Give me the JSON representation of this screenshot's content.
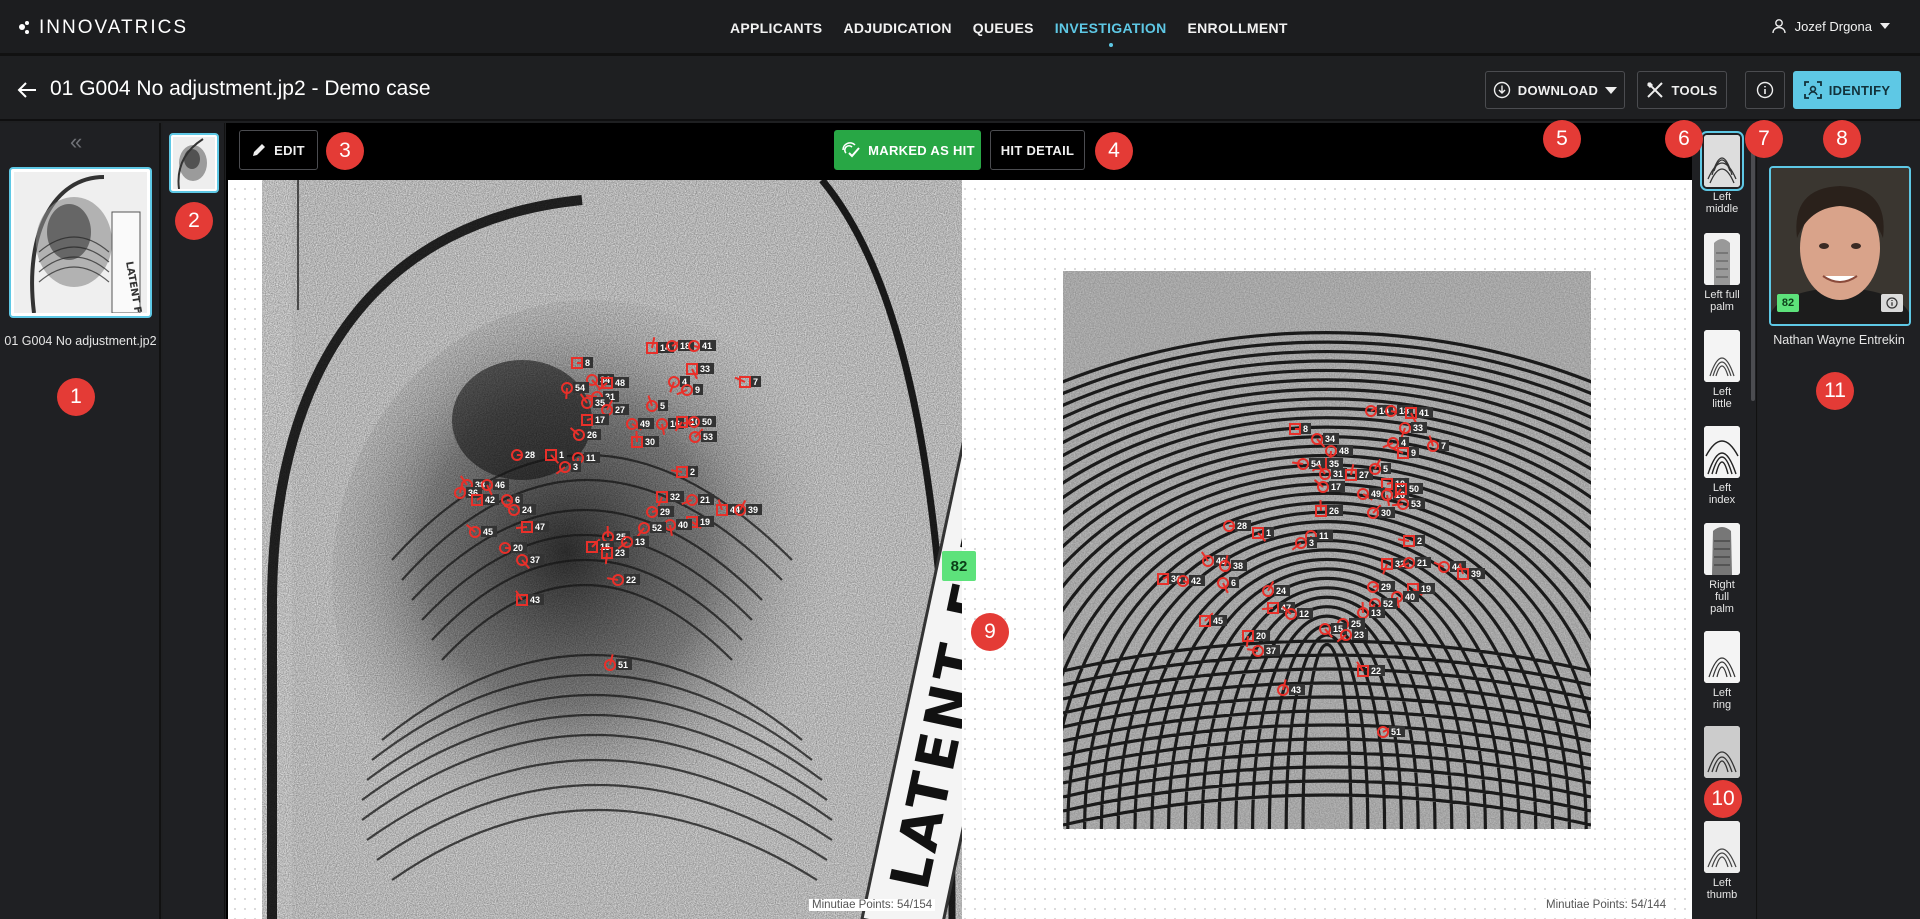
{
  "brand": {
    "name": "INNOVATRICS"
  },
  "nav": {
    "items": [
      {
        "label": "APPLICANTS"
      },
      {
        "label": "ADJUDICATION"
      },
      {
        "label": "QUEUES"
      },
      {
        "label": "INVESTIGATION",
        "active": true
      },
      {
        "label": "ENROLLMENT"
      }
    ]
  },
  "user": {
    "name": "Jozef Drgona"
  },
  "case": {
    "title": "01 G004 No adjustment.jp2 - Demo case"
  },
  "toolbar": {
    "download_label": "DOWNLOAD",
    "tools_label": "TOOLS",
    "identify_label": "IDENTIFY"
  },
  "latent": {
    "name": "01 G004 No adjustment.jp2"
  },
  "workbar": {
    "edit_label": "EDIT",
    "marked_label": "MARKED AS HIT",
    "hit_detail_label": "HIT DETAIL"
  },
  "comparison": {
    "score": "82",
    "left_minutiae": "Minutiae Points: 54/154",
    "right_minutiae": "Minutiae Points: 54/144"
  },
  "fingers": [
    {
      "label": "Left middle",
      "lines": [
        "Left",
        "middle"
      ],
      "selected": true
    },
    {
      "label": "Left full palm",
      "lines": [
        "Left full",
        "palm"
      ]
    },
    {
      "label": "Left little",
      "lines": [
        "Left",
        "little"
      ]
    },
    {
      "label": "Left index",
      "lines": [
        "Left",
        "index"
      ]
    },
    {
      "label": "Right full palm",
      "lines": [
        "Right",
        "full",
        "palm"
      ]
    },
    {
      "label": "Left ring",
      "lines": [
        "Left",
        "ring"
      ]
    },
    {
      "label": "",
      "lines": []
    },
    {
      "label": "Left thumb",
      "lines": [
        "Left",
        "thumb"
      ]
    }
  ],
  "candidate": {
    "name": "Nathan Wayne Entrekin",
    "score": "82"
  },
  "callouts": [
    "1",
    "2",
    "3",
    "4",
    "5",
    "6",
    "7",
    "8",
    "9",
    "10",
    "11"
  ],
  "colors": {
    "accent": "#5ec8e5",
    "hit": "#28a745",
    "score": "#5de27b",
    "callout": "#e43b36",
    "minutia": "#e8302a"
  }
}
